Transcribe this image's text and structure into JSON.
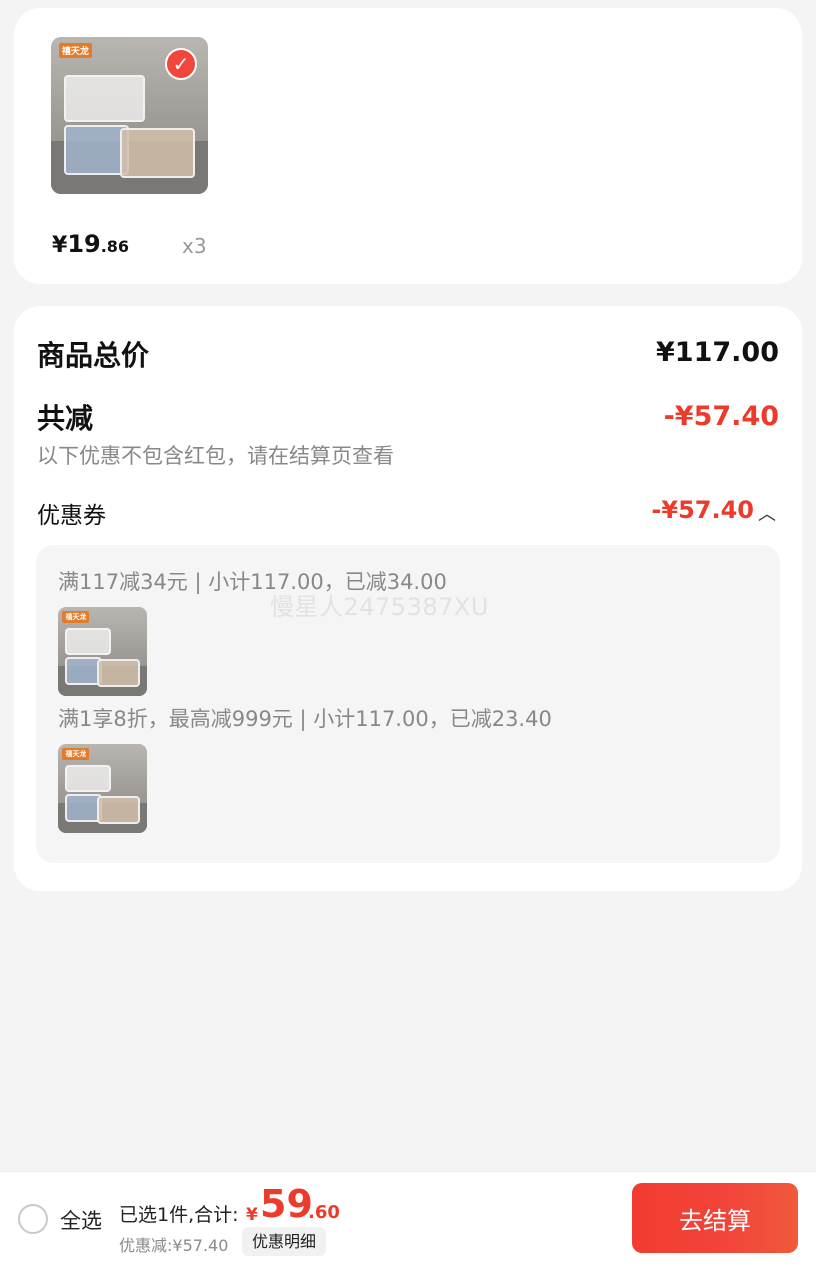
{
  "product": {
    "brand": "禧天龙",
    "price_currency": "¥",
    "price_int": "19",
    "price_dec": ".86",
    "quantity": "x3",
    "selected": true
  },
  "summary": {
    "total_label": "商品总价",
    "total_value": "¥117.00",
    "reduce_label": "共减",
    "reduce_value": "-¥57.40",
    "note": "以下优惠不包含红包，请在结算页查看",
    "coupon_label": "优惠券",
    "coupon_value": "-¥57.40",
    "details": [
      {
        "rule": "满117减34元 | 小计117.00，已减34.00"
      },
      {
        "rule": "满1享8折，最高减999元 | 小计117.00，已减23.40"
      }
    ],
    "watermark": "慢星人2475387XU"
  },
  "bottom": {
    "select_all": "全选",
    "selected_text": "已选1件,合计:",
    "total_currency": "¥",
    "total_int": "59",
    "total_dec": ".60",
    "discount_text": "优惠减:¥57.40",
    "detail_button": "优惠明细",
    "checkout_button": "去结算"
  },
  "colors": {
    "accent": "#ec3b2b",
    "checkout": "#f2453b",
    "background": "#f4f4f4"
  }
}
